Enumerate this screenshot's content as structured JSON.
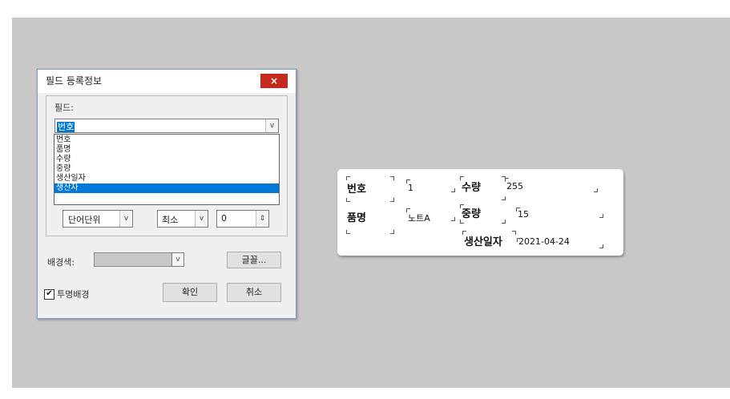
{
  "dialog": {
    "title": "필드 등록정보",
    "close_label": "×",
    "field_label": "필드:",
    "field_value": "번호",
    "dropdown_items": [
      "번호",
      "품명",
      "수량",
      "중량",
      "생산일자",
      "생산자"
    ],
    "selected_item": "생산자",
    "unit_value": "단어단위",
    "min_value": "최소",
    "number_value": "0",
    "bg_label": "배경색:",
    "font_button": "글꼴...",
    "transparent_label": "투명배경",
    "transparent_checked": true,
    "ok_button": "확인",
    "cancel_button": "취소"
  },
  "label_card": {
    "fields": {
      "bunho": {
        "name": "번호",
        "value": "1"
      },
      "pummyeong": {
        "name": "품명",
        "value": "노트A"
      },
      "suryang": {
        "name": "수량",
        "value": "255"
      },
      "jungryang": {
        "name": "중량",
        "value": "15"
      },
      "saengsan_ilja": {
        "name": "생산일자",
        "value": "2021-04-24"
      }
    }
  },
  "colors": {
    "selection": "#0078d7",
    "close": "#c42b1c",
    "canvas": "#c8c8c8"
  }
}
